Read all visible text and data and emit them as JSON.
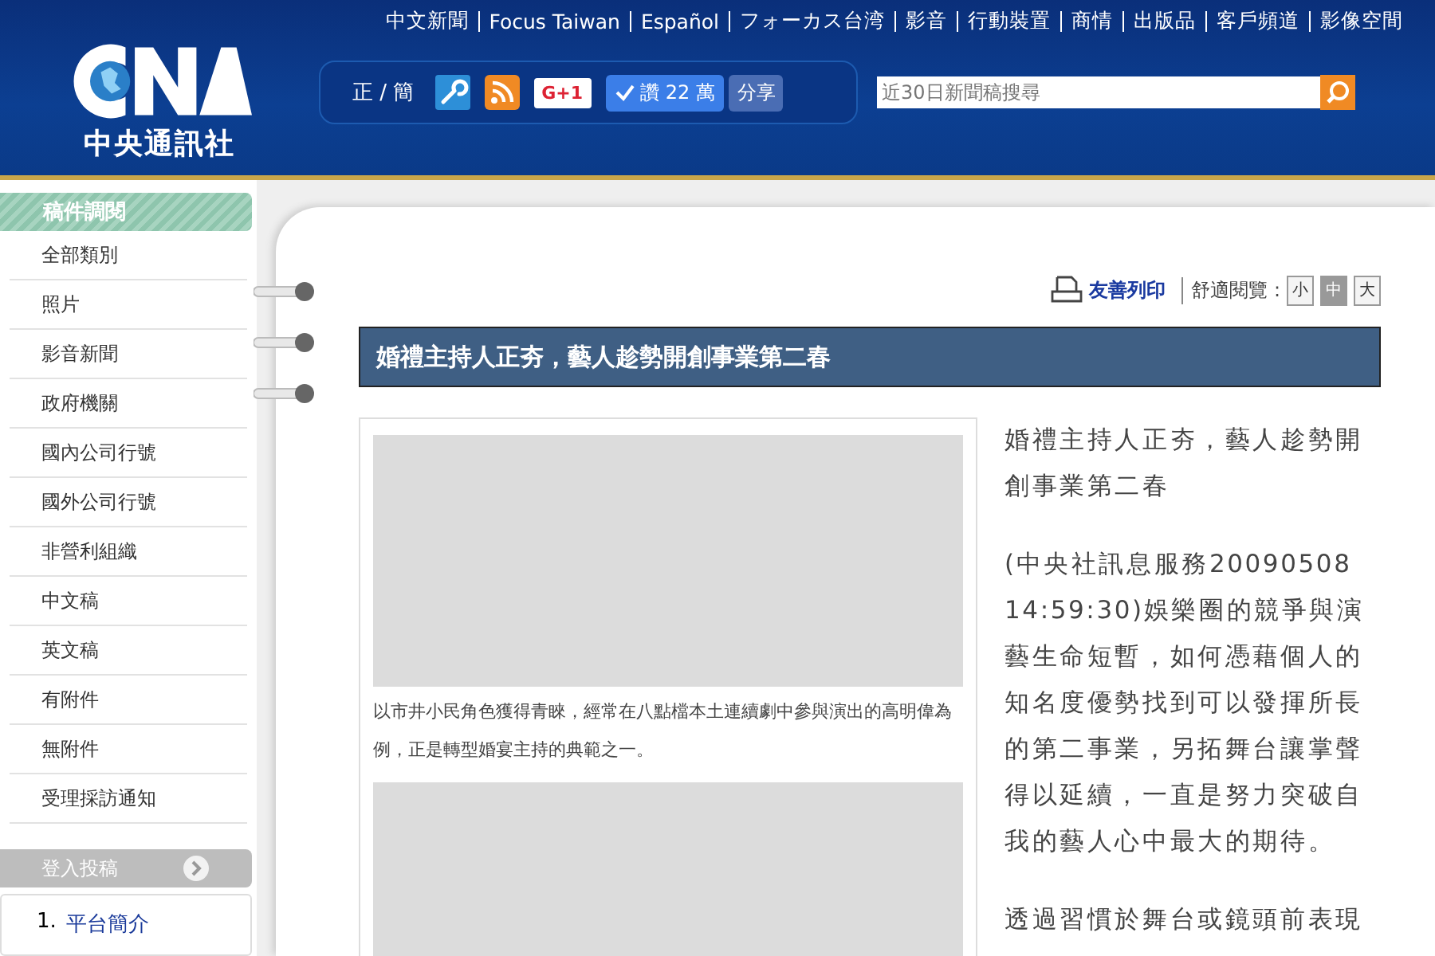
{
  "header": {
    "logo_text": "中央通訊社",
    "top_links": [
      "中文新聞",
      "Focus Taiwan",
      "Español",
      "フォーカス台湾",
      "影音",
      "行動裝置",
      "商情",
      "出版品",
      "客戶頻道",
      "影像空間"
    ],
    "toolbar": {
      "script_switch": "正 / 簡",
      "gplus": "G+1",
      "like_count": "讚 22 萬",
      "share": "分享"
    },
    "search": {
      "placeholder": "近30日新聞稿搜尋"
    }
  },
  "sidebar": {
    "title": "稿件調閱",
    "items": [
      {
        "label": "全部類別"
      },
      {
        "label": "照片"
      },
      {
        "label": "影音新聞"
      },
      {
        "label": "政府機關"
      },
      {
        "label": "國內公司行號"
      },
      {
        "label": "國外公司行號"
      },
      {
        "label": "非營利組織"
      },
      {
        "label": "中文稿"
      },
      {
        "label": "英文稿"
      },
      {
        "label": "有附件"
      },
      {
        "label": "無附件"
      },
      {
        "label": "受理採訪通知"
      }
    ],
    "login_button": "登入投稿",
    "links": [
      {
        "number": "1.",
        "label": "平台簡介"
      }
    ]
  },
  "article": {
    "print_link": "友善列印",
    "reading_label": "舒適閱覽 :",
    "font_sizes": [
      {
        "label": "小",
        "selected": false
      },
      {
        "label": "中",
        "selected": true
      },
      {
        "label": "大",
        "selected": false
      }
    ],
    "title": "婚禮主持人正夯，藝人趁勢開創事業第二春",
    "images": [
      {
        "kind": "picture",
        "caption": "以市井小民角色獲得青睞，經常在八點檔本土連續劇中參與演出的高明偉為例，正是轉型婚宴主持的典範之一。"
      },
      {
        "kind": "picture"
      }
    ],
    "paragraphs": [
      "婚禮主持人正夯，藝人趁勢開創事業第二春",
      "(中央社訊息服務20090508 14:59:30)娛樂圈的競爭與演藝生命短暫，如何憑藉個人的知名度優勢找到可以發揮所長的第二事業，另拓舞台讓掌聲得以延續，一直是努力突破自我的藝人心中最大的期待。",
      "透過習慣於舞台或鏡頭前表現"
    ]
  }
}
